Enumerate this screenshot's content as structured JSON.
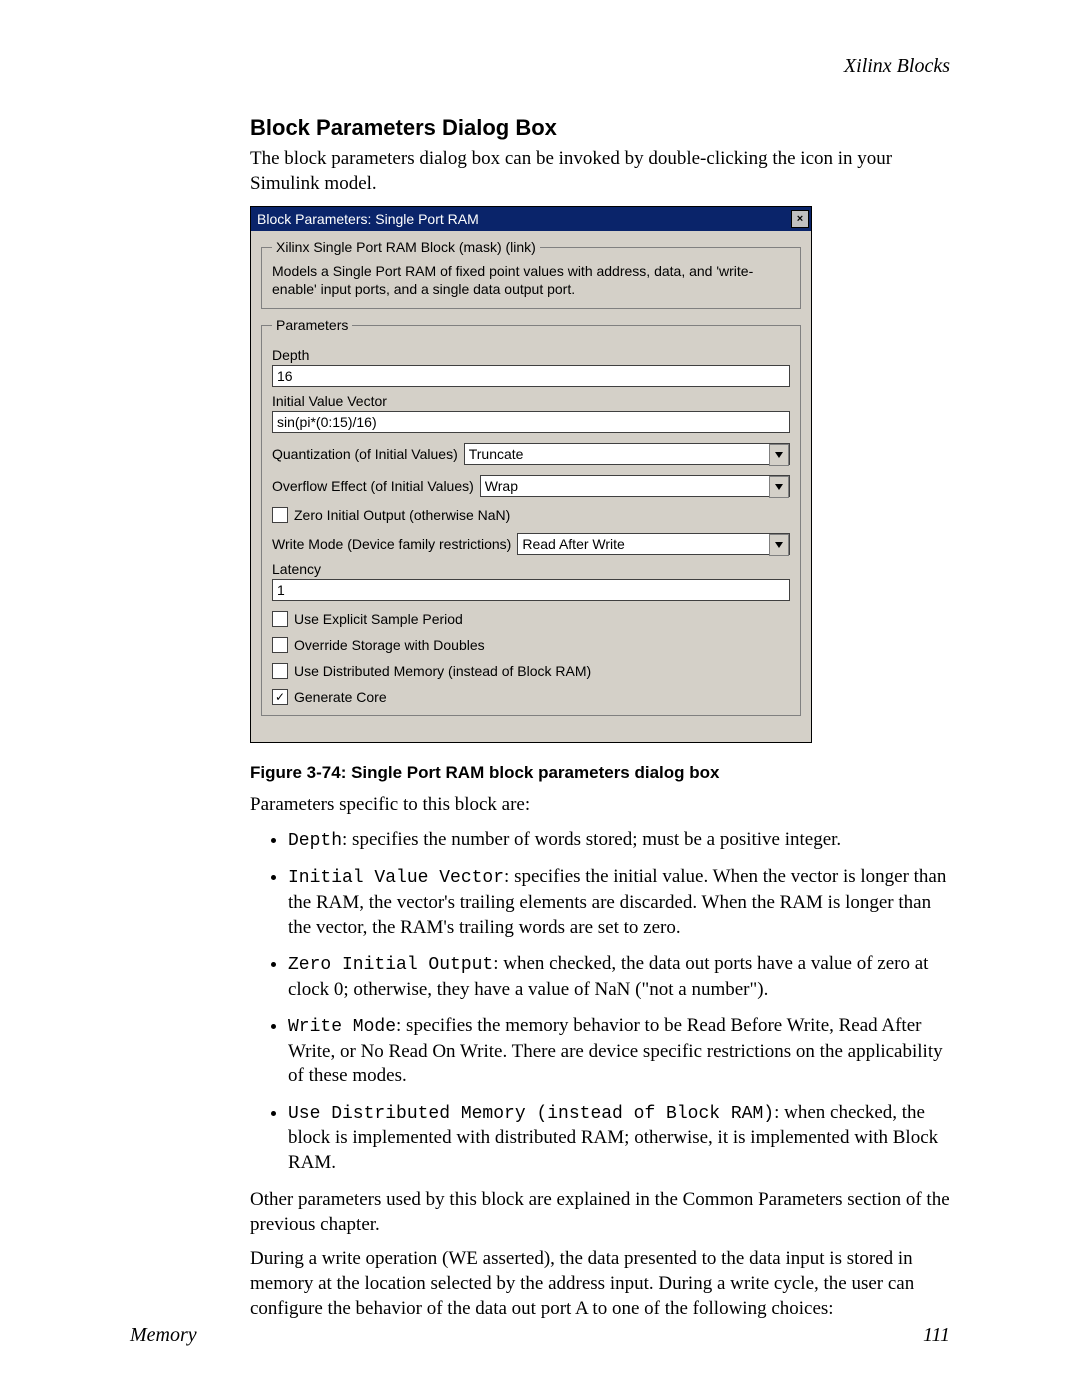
{
  "header": {
    "running_head": "Xilinx Blocks"
  },
  "section": {
    "title": "Block Parameters Dialog Box",
    "intro": "The block parameters dialog box can be invoked by double-clicking the icon in your Simulink model."
  },
  "dialog": {
    "title": "Block Parameters: Single Port RAM",
    "close_glyph": "×",
    "mask": {
      "legend": "Xilinx Single Port RAM Block (mask) (link)",
      "description": "Models a Single Port RAM of fixed point values with address, data, and 'write-enable' input ports, and a single data output port."
    },
    "params": {
      "legend": "Parameters",
      "depth_label": "Depth",
      "depth_value": "16",
      "ivv_label": "Initial Value Vector",
      "ivv_value": "sin(pi*(0:15)/16)",
      "quant_label": "Quantization (of Initial Values)",
      "quant_value": "Truncate",
      "overflow_label": "Overflow Effect (of Initial Values)",
      "overflow_value": "Wrap",
      "zero_label": "Zero Initial Output  (otherwise NaN)",
      "writemode_label": "Write Mode (Device family restrictions)",
      "writemode_value": "Read After Write",
      "latency_label": "Latency",
      "latency_value": "1",
      "explicit_label": "Use Explicit Sample Period",
      "override_label": "Override Storage with Doubles",
      "distmem_label": "Use Distributed Memory (instead of Block RAM)",
      "gencore_label": "Generate Core"
    }
  },
  "figure": {
    "caption": "Figure 3-74:   Single Port RAM block parameters dialog box"
  },
  "after": {
    "lead": "Parameters specific to this block are:",
    "bullets": [
      {
        "term": "Depth",
        "text": ": specifies the number of words stored; must be a positive integer."
      },
      {
        "term": "Initial Value Vector",
        "text": ": specifies the initial value. When the vector is longer than the RAM, the vector's trailing elements are discarded. When the RAM is longer than the vector, the RAM's trailing words are set to zero."
      },
      {
        "term": "Zero Initial Output",
        "text": ": when checked, the data out ports have a value of zero at clock 0; otherwise, they have a value of NaN (\"not a number\")."
      },
      {
        "term": "Write Mode",
        "text": ": specifies the memory behavior to be Read Before Write, Read After Write, or No Read On Write. There are device specific restrictions on the applicability of these modes."
      },
      {
        "term": "Use Distributed Memory (instead of Block RAM)",
        "text": ": when checked, the block is implemented with distributed RAM; otherwise, it is implemented with Block RAM."
      }
    ],
    "p1": "Other parameters used by this block are explained in the Common Parameters section of the previous chapter.",
    "p2": "During a write operation (WE asserted), the data presented to the data input is stored in memory at the location selected by the address input. During a write cycle, the user can configure the behavior of the data out port A to one of the following choices:"
  },
  "footer": {
    "left": "Memory",
    "right": "111"
  }
}
